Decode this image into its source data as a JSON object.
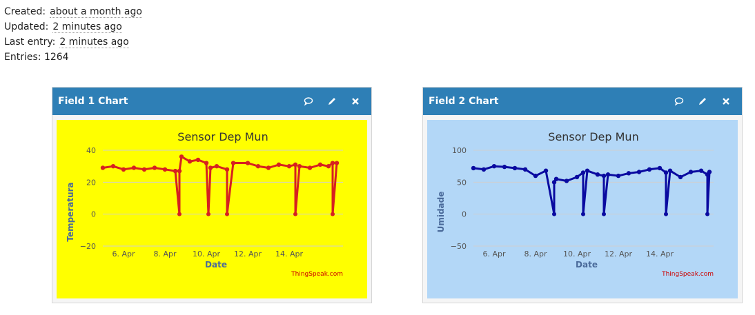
{
  "meta": {
    "created_label": "Created:",
    "created_value": "about a month ago",
    "updated_label": "Updated:",
    "updated_value": "2 minutes ago",
    "last_entry_label": "Last entry:",
    "last_entry_value": "2 minutes ago",
    "entries_label": "Entries:",
    "entries_value": "1264"
  },
  "panels": [
    {
      "title": "Field 1 Chart",
      "icons": [
        "comment-icon",
        "pencil-icon",
        "close-icon"
      ],
      "bg_color": "#ffff00",
      "line_color": "#d62020",
      "credit": "ThingSpeak.com"
    },
    {
      "title": "Field 2 Chart",
      "icons": [
        "comment-icon",
        "pencil-icon",
        "close-icon"
      ],
      "bg_color": "#b3d7f7",
      "line_color": "#0a0aa0",
      "credit": "ThingSpeak.com"
    }
  ],
  "chart_data": [
    {
      "type": "line",
      "title": "Sensor Dep Mun",
      "xlabel": "Date",
      "ylabel": "Temperatura",
      "x_ticks": [
        "6. Apr",
        "8. Apr",
        "10. Apr",
        "12. Apr",
        "14. Apr"
      ],
      "y_ticks": [
        "40",
        "20",
        "0",
        "−20"
      ],
      "ylim": [
        -20,
        40
      ],
      "grid": true,
      "series": [
        {
          "x": [
            "2016-04-05",
            "2016-04-05.5",
            "2016-04-06",
            "2016-04-06.5",
            "2016-04-07",
            "2016-04-07.5",
            "2016-04-08",
            "2016-04-08.5",
            "2016-04-08.7",
            "2016-04-08.7",
            "2016-04-08.8",
            "2016-04-09.2",
            "2016-04-09.6",
            "2016-04-10",
            "2016-04-10.1",
            "2016-04-10.2",
            "2016-04-10.5",
            "2016-04-11",
            "2016-04-11",
            "2016-04-11.3",
            "2016-04-12",
            "2016-04-12.5",
            "2016-04-13",
            "2016-04-13.5",
            "2016-04-14",
            "2016-04-14.3",
            "2016-04-14.3",
            "2016-04-14.5",
            "2016-04-15",
            "2016-04-15.5",
            "2016-04-15.9",
            "2016-04-16.1",
            "2016-04-16.1",
            "2016-04-16.3"
          ],
          "values": [
            29,
            30,
            28,
            29,
            28,
            29,
            28,
            27,
            0,
            27,
            36,
            33,
            34,
            32,
            0,
            29,
            30,
            28,
            0,
            32,
            32,
            30,
            29,
            31,
            30,
            31,
            0,
            30,
            29,
            31,
            30,
            32,
            0,
            32
          ]
        }
      ]
    },
    {
      "type": "line",
      "title": "Sensor Dep Mun",
      "xlabel": "Date",
      "ylabel": "Umidade",
      "x_ticks": [
        "6. Apr",
        "8. Apr",
        "10. Apr",
        "12. Apr",
        "14. Apr"
      ],
      "y_ticks": [
        "100",
        "50",
        "0",
        "−50"
      ],
      "ylim": [
        -50,
        100
      ],
      "grid": true,
      "series": [
        {
          "x": [
            "2016-04-05",
            "2016-04-05.5",
            "2016-04-06",
            "2016-04-06.5",
            "2016-04-07",
            "2016-04-07.5",
            "2016-04-08",
            "2016-04-08.5",
            "2016-04-08.9",
            "2016-04-08.9",
            "2016-04-09",
            "2016-04-09.5",
            "2016-04-10",
            "2016-04-10.3",
            "2016-04-10.3",
            "2016-04-10.5",
            "2016-04-11",
            "2016-04-11.3",
            "2016-04-11.3",
            "2016-04-11.5",
            "2016-04-12",
            "2016-04-12.5",
            "2016-04-13",
            "2016-04-13.5",
            "2016-04-14",
            "2016-04-14.3",
            "2016-04-14.3",
            "2016-04-14.5",
            "2016-04-15",
            "2016-04-15.5",
            "2016-04-16",
            "2016-04-16.3",
            "2016-04-16.3",
            "2016-04-16.4"
          ],
          "values": [
            72,
            70,
            75,
            74,
            72,
            70,
            60,
            68,
            0,
            50,
            55,
            52,
            58,
            65,
            0,
            68,
            62,
            60,
            0,
            62,
            60,
            64,
            66,
            70,
            72,
            65,
            0,
            68,
            58,
            66,
            68,
            62,
            0,
            66
          ]
        }
      ]
    }
  ]
}
